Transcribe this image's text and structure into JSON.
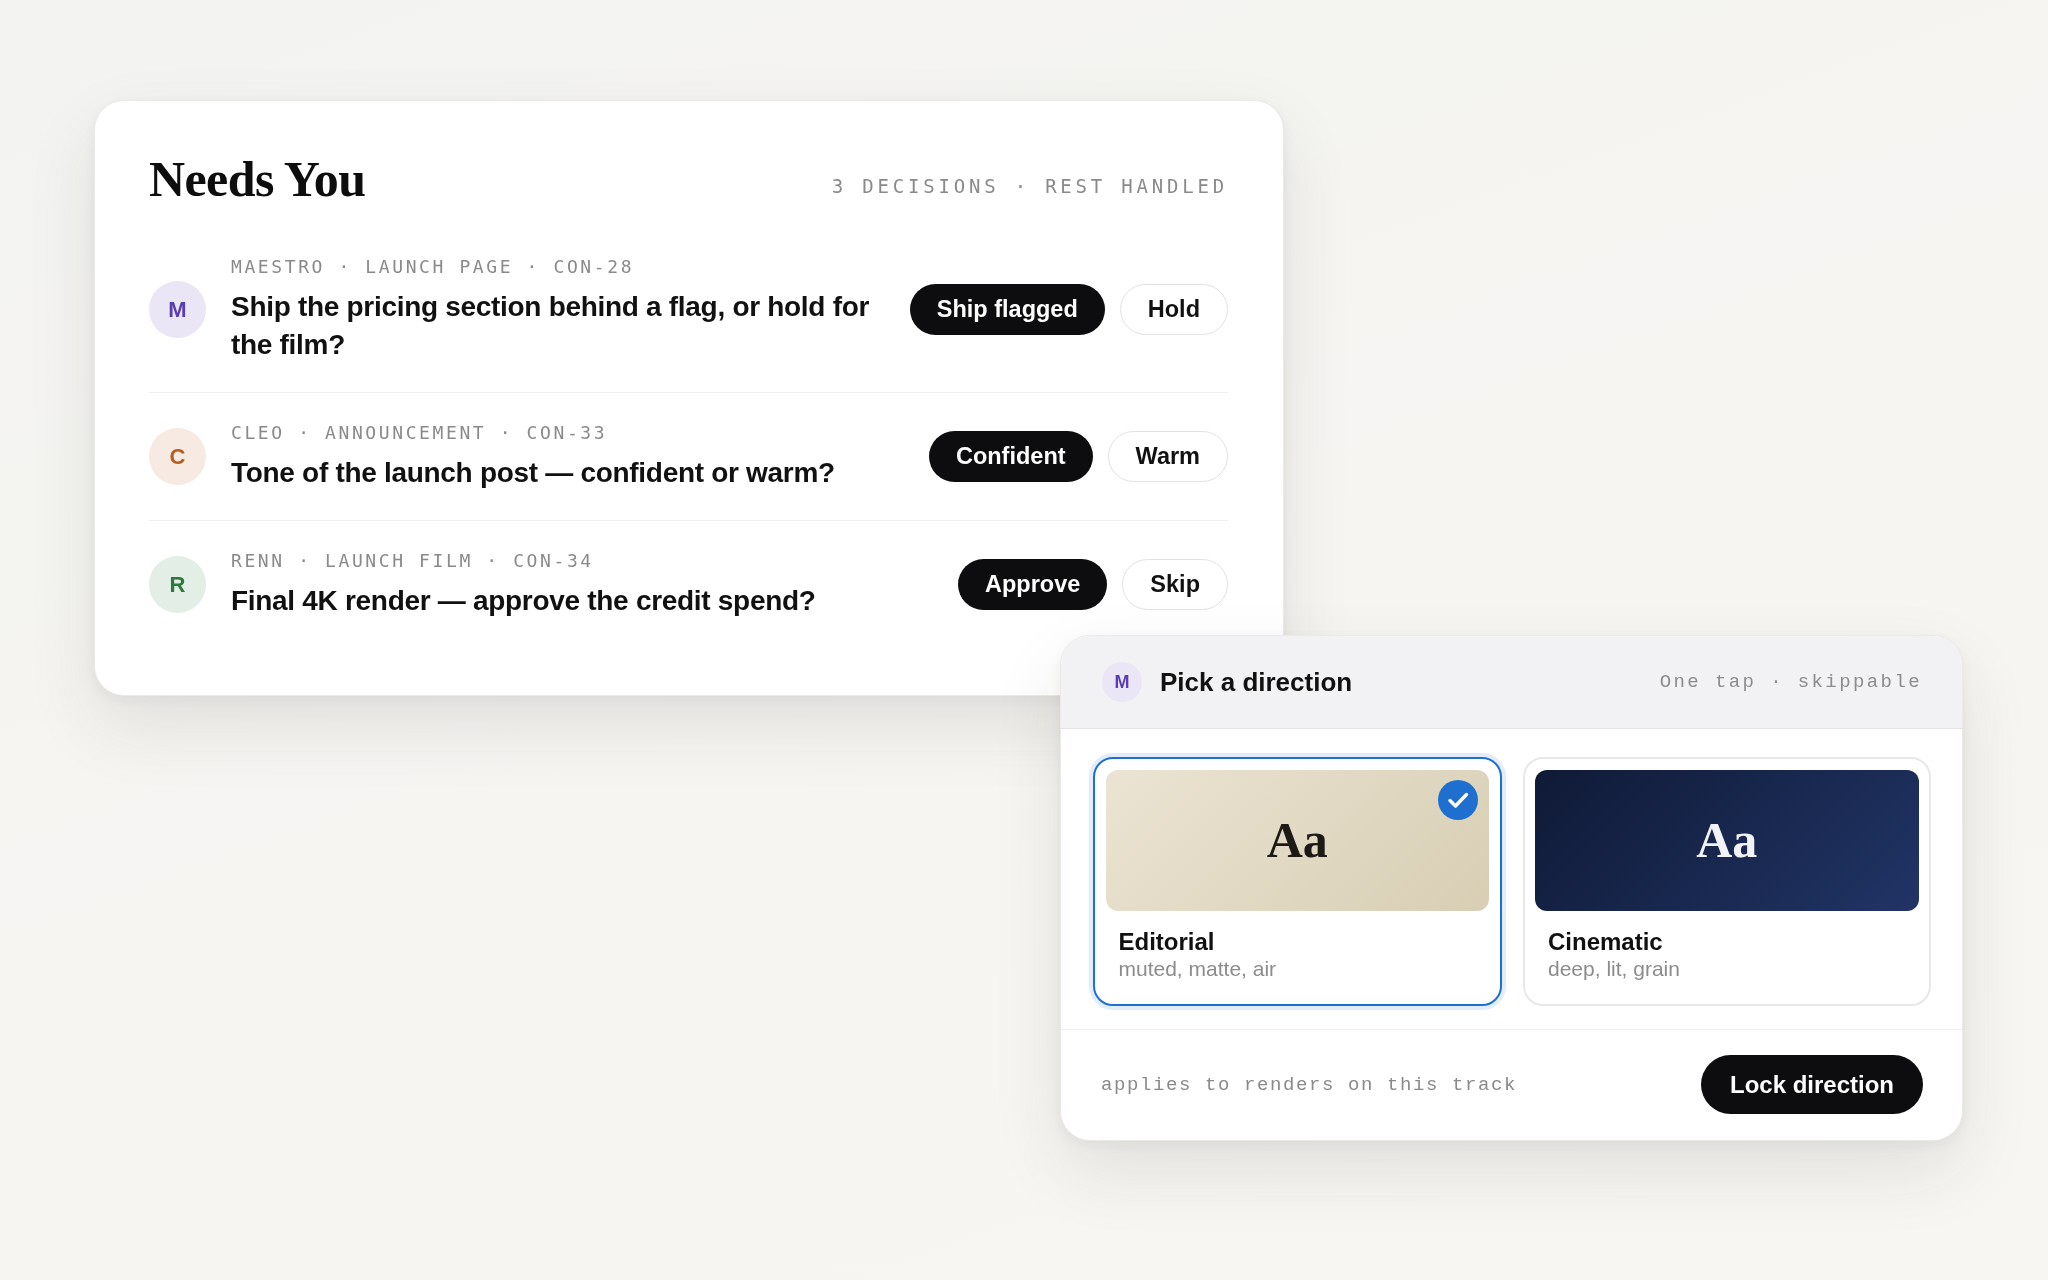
{
  "needs_you": {
    "title": "Needs You",
    "summary": "3 DECISIONS · REST HANDLED",
    "decisions": [
      {
        "avatar": {
          "letter": "M",
          "color": "#5a3db0"
        },
        "meta": "MAESTRO · LAUNCH PAGE · CON-28",
        "question": "Ship the pricing section behind a flag, or hold for the film?",
        "actions": [
          {
            "label": "Ship flagged",
            "kind": "primary"
          },
          {
            "label": "Hold",
            "kind": "secondary"
          }
        ]
      },
      {
        "avatar": {
          "letter": "C",
          "color": "#b85d22"
        },
        "meta": "CLEO · ANNOUNCEMENT · CON-33",
        "question": "Tone of the launch post — confident or warm?",
        "actions": [
          {
            "label": "Confident",
            "kind": "primary"
          },
          {
            "label": "Warm",
            "kind": "secondary"
          }
        ]
      },
      {
        "avatar": {
          "letter": "R",
          "color": "#2b7a3b"
        },
        "meta": "RENN · LAUNCH FILM · CON-34",
        "question": "Final 4K render — approve the credit spend?",
        "actions": [
          {
            "label": "Approve",
            "kind": "primary"
          },
          {
            "label": "Skip",
            "kind": "secondary"
          }
        ]
      }
    ]
  },
  "direction_picker": {
    "avatar": {
      "letter": "M",
      "color": "#5a3db0"
    },
    "title": "Pick a direction",
    "hint": "One tap · skippable",
    "options": [
      {
        "sample": "Aa",
        "kind": "light",
        "name": "Editorial",
        "description": "muted, matte, air",
        "selected": true
      },
      {
        "sample": "Aa",
        "kind": "dark",
        "name": "Cinematic",
        "description": "deep, lit, grain",
        "selected": false
      }
    ],
    "footnote": "applies to renders on this track",
    "action": "Lock direction"
  }
}
